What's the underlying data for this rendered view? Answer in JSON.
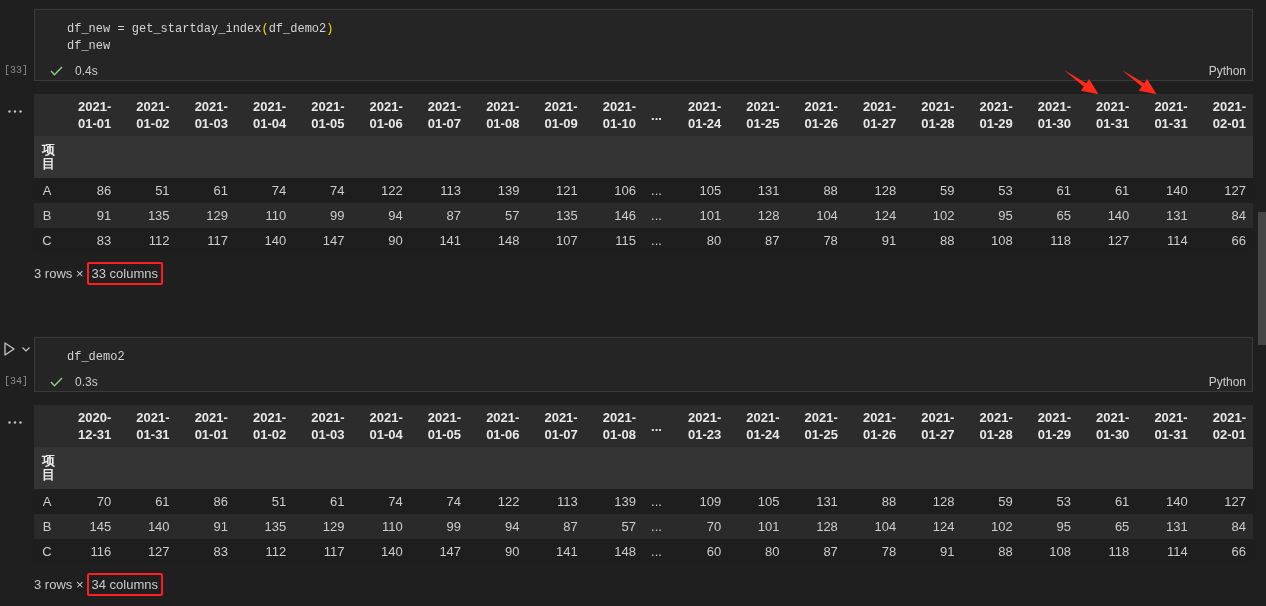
{
  "cells": [
    {
      "execution_count": "[33]",
      "hovered": false,
      "code_lines": [
        {
          "tokens": [
            {
              "kind": "text",
              "text": "df_new = get_startday_index"
            },
            {
              "kind": "bracket",
              "text": "("
            },
            {
              "kind": "text",
              "text": "df_demo2"
            },
            {
              "kind": "bracket",
              "text": ")"
            }
          ]
        },
        {
          "tokens": [
            {
              "kind": "text",
              "text": "df_new"
            }
          ]
        }
      ],
      "status": {
        "succeeded": true,
        "duration": "0.4s"
      },
      "language": "Python",
      "output": {
        "table": {
          "index_name": "项目",
          "columns": [
            {
              "kind": "date",
              "label": "2021-01-01",
              "arrow": false
            },
            {
              "kind": "date",
              "label": "2021-01-02",
              "arrow": false
            },
            {
              "kind": "date",
              "label": "2021-01-03",
              "arrow": false
            },
            {
              "kind": "date",
              "label": "2021-01-04",
              "arrow": false
            },
            {
              "kind": "date",
              "label": "2021-01-05",
              "arrow": false
            },
            {
              "kind": "date",
              "label": "2021-01-06",
              "arrow": false
            },
            {
              "kind": "date",
              "label": "2021-01-07",
              "arrow": false
            },
            {
              "kind": "date",
              "label": "2021-01-08",
              "arrow": false
            },
            {
              "kind": "date",
              "label": "2021-01-09",
              "arrow": false
            },
            {
              "kind": "date",
              "label": "2021-01-10",
              "arrow": false
            },
            {
              "kind": "ellipsis",
              "label": "...",
              "arrow": false
            },
            {
              "kind": "date",
              "label": "2021-01-24",
              "arrow": false
            },
            {
              "kind": "date",
              "label": "2021-01-25",
              "arrow": false
            },
            {
              "kind": "date",
              "label": "2021-01-26",
              "arrow": false
            },
            {
              "kind": "date",
              "label": "2021-01-27",
              "arrow": false
            },
            {
              "kind": "date",
              "label": "2021-01-28",
              "arrow": false
            },
            {
              "kind": "date",
              "label": "2021-01-29",
              "arrow": false
            },
            {
              "kind": "date",
              "label": "2021-01-30",
              "arrow": false
            },
            {
              "kind": "date",
              "label": "2021-01-31",
              "arrow": true
            },
            {
              "kind": "date",
              "label": "2021-01-31",
              "arrow": true
            },
            {
              "kind": "date",
              "label": "2021-02-01",
              "arrow": false
            }
          ],
          "rows": [
            {
              "label": "A",
              "values": [
                "86",
                "51",
                "61",
                "74",
                "74",
                "122",
                "113",
                "139",
                "121",
                "106",
                "...",
                "105",
                "131",
                "88",
                "128",
                "59",
                "53",
                "61",
                "61",
                "140",
                "127"
              ]
            },
            {
              "label": "B",
              "values": [
                "91",
                "135",
                "129",
                "110",
                "99",
                "94",
                "87",
                "57",
                "135",
                "146",
                "...",
                "101",
                "128",
                "104",
                "124",
                "102",
                "95",
                "65",
                "140",
                "131",
                "84"
              ]
            },
            {
              "label": "C",
              "values": [
                "83",
                "112",
                "117",
                "140",
                "147",
                "90",
                "141",
                "148",
                "107",
                "115",
                "...",
                "80",
                "87",
                "78",
                "91",
                "88",
                "108",
                "118",
                "127",
                "114",
                "66"
              ]
            }
          ]
        },
        "summary": {
          "shape": "3 rows ×",
          "column_count": "33 columns",
          "highlighted": true
        }
      }
    },
    {
      "execution_count": "[34]",
      "hovered": true,
      "code_lines": [
        {
          "tokens": [
            {
              "kind": "text",
              "text": "df_demo2"
            }
          ]
        }
      ],
      "status": {
        "succeeded": true,
        "duration": "0.3s"
      },
      "language": "Python",
      "output": {
        "table": {
          "index_name": "项目",
          "columns": [
            {
              "kind": "date",
              "label": "2020-12-31",
              "arrow": false
            },
            {
              "kind": "date",
              "label": "2021-01-31",
              "arrow": false
            },
            {
              "kind": "date",
              "label": "2021-01-01",
              "arrow": false
            },
            {
              "kind": "date",
              "label": "2021-01-02",
              "arrow": false
            },
            {
              "kind": "date",
              "label": "2021-01-03",
              "arrow": false
            },
            {
              "kind": "date",
              "label": "2021-01-04",
              "arrow": false
            },
            {
              "kind": "date",
              "label": "2021-01-05",
              "arrow": false
            },
            {
              "kind": "date",
              "label": "2021-01-06",
              "arrow": false
            },
            {
              "kind": "date",
              "label": "2021-01-07",
              "arrow": false
            },
            {
              "kind": "date",
              "label": "2021-01-08",
              "arrow": false
            },
            {
              "kind": "ellipsis",
              "label": "...",
              "arrow": false
            },
            {
              "kind": "date",
              "label": "2021-01-23",
              "arrow": false
            },
            {
              "kind": "date",
              "label": "2021-01-24",
              "arrow": false
            },
            {
              "kind": "date",
              "label": "2021-01-25",
              "arrow": false
            },
            {
              "kind": "date",
              "label": "2021-01-26",
              "arrow": false
            },
            {
              "kind": "date",
              "label": "2021-01-27",
              "arrow": false
            },
            {
              "kind": "date",
              "label": "2021-01-28",
              "arrow": false
            },
            {
              "kind": "date",
              "label": "2021-01-29",
              "arrow": false
            },
            {
              "kind": "date",
              "label": "2021-01-30",
              "arrow": false
            },
            {
              "kind": "date",
              "label": "2021-01-31",
              "arrow": false
            },
            {
              "kind": "date",
              "label": "2021-02-01",
              "arrow": false
            }
          ],
          "rows": [
            {
              "label": "A",
              "values": [
                "70",
                "61",
                "86",
                "51",
                "61",
                "74",
                "74",
                "122",
                "113",
                "139",
                "...",
                "109",
                "105",
                "131",
                "88",
                "128",
                "59",
                "53",
                "61",
                "140",
                "127"
              ]
            },
            {
              "label": "B",
              "values": [
                "145",
                "140",
                "91",
                "135",
                "129",
                "110",
                "99",
                "94",
                "87",
                "57",
                "...",
                "70",
                "101",
                "128",
                "104",
                "124",
                "102",
                "95",
                "65",
                "131",
                "84"
              ]
            },
            {
              "label": "C",
              "values": [
                "116",
                "127",
                "83",
                "112",
                "117",
                "140",
                "147",
                "90",
                "141",
                "148",
                "...",
                "60",
                "80",
                "87",
                "78",
                "91",
                "88",
                "108",
                "118",
                "114",
                "66"
              ]
            }
          ]
        },
        "summary": {
          "shape": "3 rows ×",
          "column_count": "34 columns",
          "highlighted": true
        }
      }
    }
  ]
}
